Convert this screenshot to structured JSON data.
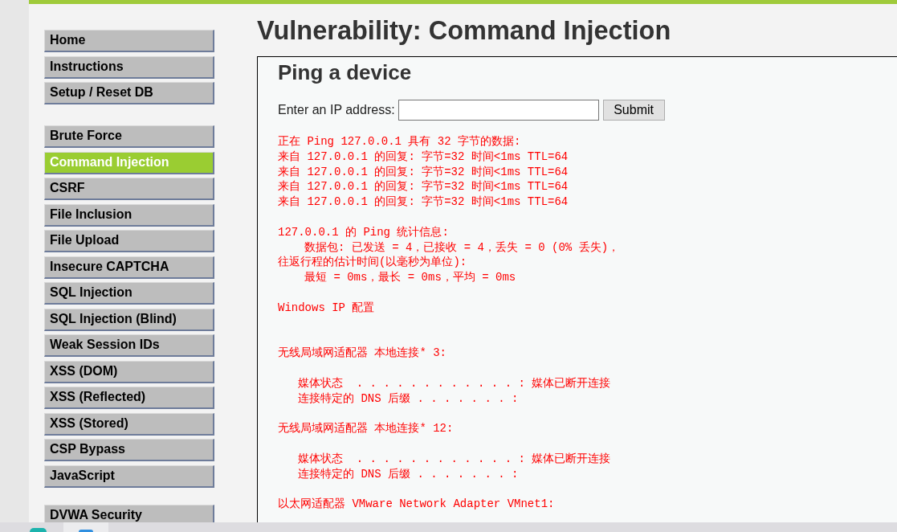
{
  "sidebar": {
    "groups": [
      {
        "items": [
          {
            "label": "Home",
            "selected": false
          },
          {
            "label": "Instructions",
            "selected": false
          },
          {
            "label": "Setup / Reset DB",
            "selected": false
          }
        ]
      },
      {
        "items": [
          {
            "label": "Brute Force",
            "selected": false
          },
          {
            "label": "Command Injection",
            "selected": true
          },
          {
            "label": "CSRF",
            "selected": false
          },
          {
            "label": "File Inclusion",
            "selected": false
          },
          {
            "label": "File Upload",
            "selected": false
          },
          {
            "label": "Insecure CAPTCHA",
            "selected": false
          },
          {
            "label": "SQL Injection",
            "selected": false
          },
          {
            "label": "SQL Injection (Blind)",
            "selected": false
          },
          {
            "label": "Weak Session IDs",
            "selected": false
          },
          {
            "label": "XSS (DOM)",
            "selected": false
          },
          {
            "label": "XSS (Reflected)",
            "selected": false
          },
          {
            "label": "XSS (Stored)",
            "selected": false
          },
          {
            "label": "CSP Bypass",
            "selected": false
          },
          {
            "label": "JavaScript",
            "selected": false
          }
        ]
      },
      {
        "items": [
          {
            "label": "DVWA Security",
            "selected": false
          }
        ]
      }
    ]
  },
  "page": {
    "title": "Vulnerability: Command Injection"
  },
  "panel": {
    "title": "Ping a device",
    "form": {
      "label": "Enter an IP address:",
      "submit_button": "Submit"
    },
    "output": {
      "blocks": [
        {
          "kind": "section",
          "lines": [
            {
              "kind": "plain",
              "text": "正在 Ping 127.0.0.1 具有 32 字节的数据:"
            },
            {
              "kind": "plain",
              "text": "来自 127.0.0.1 的回复: 字节=32 时间<1ms TTL=64"
            },
            {
              "kind": "plain",
              "text": "来自 127.0.0.1 的回复: 字节=32 时间<1ms TTL=64"
            },
            {
              "kind": "plain",
              "text": "来自 127.0.0.1 的回复: 字节=32 时间<1ms TTL=64"
            },
            {
              "kind": "plain",
              "text": "来自 127.0.0.1 的回复: 字节=32 时间<1ms TTL=64"
            }
          ]
        },
        {
          "kind": "section",
          "lines": [
            {
              "kind": "plain",
              "text": "127.0.0.1 的 Ping 统计信息:"
            },
            {
              "kind": "stat",
              "text": "数据包: 已发送 = 4，已接收 = 4，丢失 = 0 (0% 丢失)，"
            },
            {
              "kind": "plain",
              "text": "往返行程的估计时间(以毫秒为单位):"
            },
            {
              "kind": "stat",
              "text": "最短 = 0ms，最长 = 0ms，平均 = 0ms"
            }
          ]
        },
        {
          "kind": "title",
          "lines": [
            {
              "kind": "plain",
              "text": "Windows IP 配置"
            }
          ]
        },
        {
          "kind": "section",
          "lines": [
            {
              "kind": "plain",
              "text": "无线局域网适配器 本地连接* 3:"
            }
          ]
        },
        {
          "kind": "section",
          "lines": [
            {
              "kind": "field",
              "text": "媒体状态  . . . . . . . . . . . . : 媒体已断开连接"
            },
            {
              "kind": "field",
              "text": "连接特定的 DNS 后缀 . . . . . . . :"
            }
          ]
        },
        {
          "kind": "section",
          "lines": [
            {
              "kind": "plain",
              "text": "无线局域网适配器 本地连接* 12:"
            }
          ]
        },
        {
          "kind": "section",
          "lines": [
            {
              "kind": "field",
              "text": "媒体状态  . . . . . . . . . . . . : 媒体已断开连接"
            },
            {
              "kind": "field",
              "text": "连接特定的 DNS 后缀 . . . . . . . :"
            }
          ]
        },
        {
          "kind": "section",
          "lines": [
            {
              "kind": "plain",
              "text": "以太网适配器 VMware Network Adapter VMnet1:"
            }
          ]
        }
      ]
    }
  }
}
